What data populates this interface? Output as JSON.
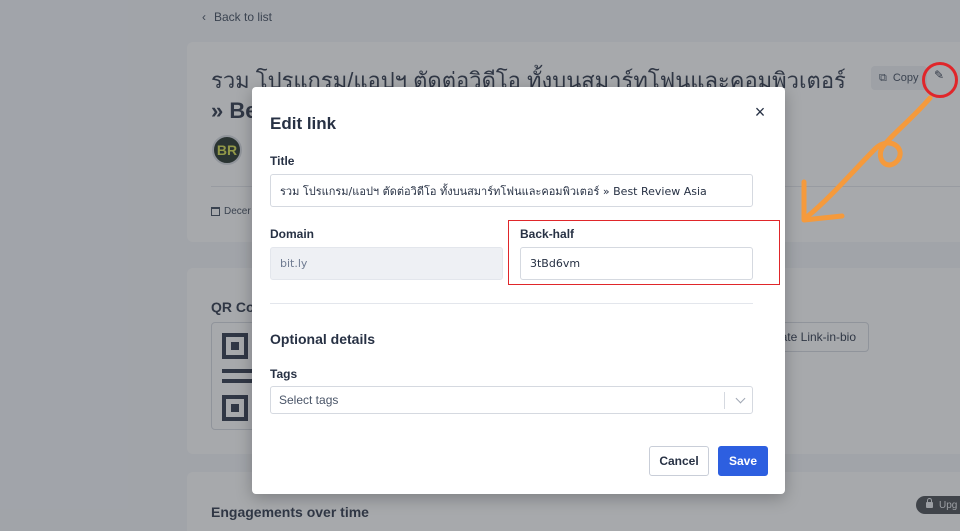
{
  "page": {
    "back_link": "Back to list",
    "link_title_main": "รวม โปรแกรม/แอปฯ ตัดต่อวิดีโอ ทั้งบนสมาร์ทโฟนและคอมพิวเตอร์",
    "link_title_tail": "» Be",
    "copy_label": "Copy",
    "avatar_initials": "BR",
    "date_label": "Decer",
    "qr_heading": "QR Co",
    "linkbio_label": "ate Link-in-bio",
    "engagements_heading": "Engagements over time",
    "upgrade_label": "Upg"
  },
  "modal": {
    "title": "Edit link",
    "title_label": "Title",
    "title_value": "รวม โปรแกรม/แอปฯ ตัดต่อวิดีโอ ทั้งบนสมาร์ทโฟนและคอมพิวเตอร์ » Best Review Asia",
    "domain_label": "Domain",
    "domain_value": "bit.ly",
    "backhalf_label": "Back-half",
    "backhalf_value": "3tBd6vm",
    "optional_heading": "Optional details",
    "tags_label": "Tags",
    "tags_placeholder": "Select tags",
    "cancel_label": "Cancel",
    "save_label": "Save"
  },
  "colors": {
    "primary": "#2d5fe0",
    "annotation_red": "#e0262a",
    "annotation_orange": "#f59a3c"
  }
}
